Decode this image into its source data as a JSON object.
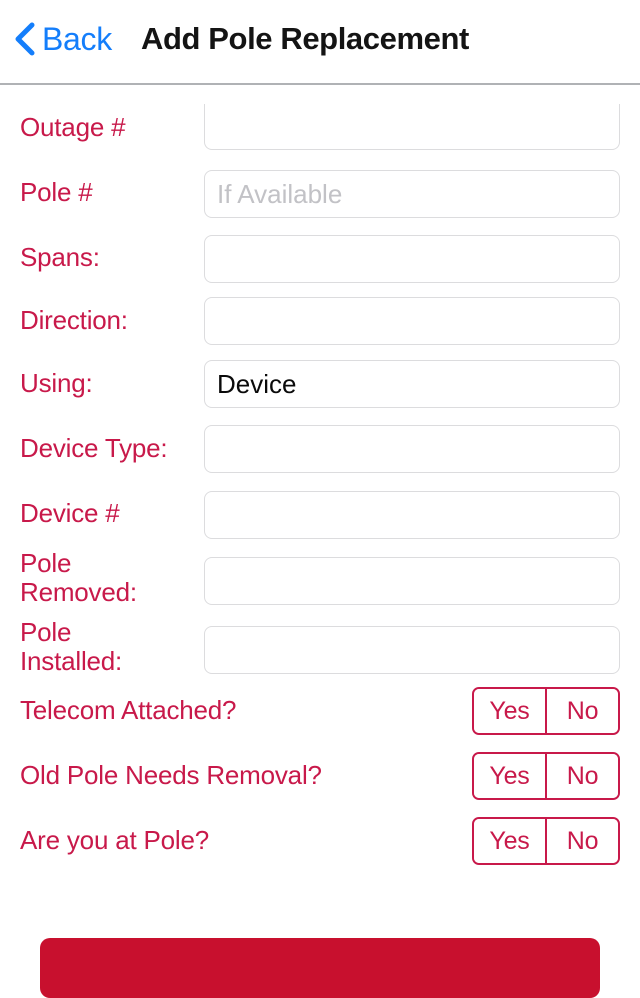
{
  "navbar": {
    "back_label": "Back",
    "back_icon": "chevron-left-icon",
    "title": "Add Pole Replacement",
    "back_color": "#147EFB",
    "title_color": "#141414"
  },
  "theme": {
    "label_color": "#C8194A",
    "accent_color": "#C8102E",
    "field_border": "#DCDCDE",
    "placeholder_color": "#C2C2C6"
  },
  "form": {
    "fields": [
      {
        "label": "Outage #",
        "type": "text",
        "value": "",
        "placeholder": ""
      },
      {
        "label": "Pole #",
        "type": "text",
        "value": "",
        "placeholder": "If Available"
      },
      {
        "label": "Spans:",
        "type": "text",
        "value": "",
        "placeholder": ""
      },
      {
        "label": "Direction:",
        "type": "text",
        "value": "",
        "placeholder": ""
      },
      {
        "label": "Using:",
        "type": "text",
        "value": "Device",
        "placeholder": ""
      },
      {
        "label": "Device Type:",
        "type": "text",
        "value": "",
        "placeholder": ""
      },
      {
        "label": "Device #",
        "type": "text",
        "value": "",
        "placeholder": ""
      },
      {
        "label": "Pole Removed:",
        "type": "text",
        "value": "",
        "placeholder": ""
      },
      {
        "label": "Pole Installed:",
        "type": "text",
        "value": "",
        "placeholder": ""
      },
      {
        "label": "Telecom Attached?",
        "type": "segmented",
        "options": [
          "Yes",
          "No"
        ],
        "selected": ""
      },
      {
        "label": "Old Pole Needs Removal?",
        "type": "segmented",
        "options": [
          "Yes",
          "No"
        ],
        "selected": ""
      },
      {
        "label": "Are you at Pole?",
        "type": "segmented",
        "options": [
          "Yes",
          "No"
        ],
        "selected": ""
      }
    ]
  },
  "submit": {
    "label": ""
  }
}
